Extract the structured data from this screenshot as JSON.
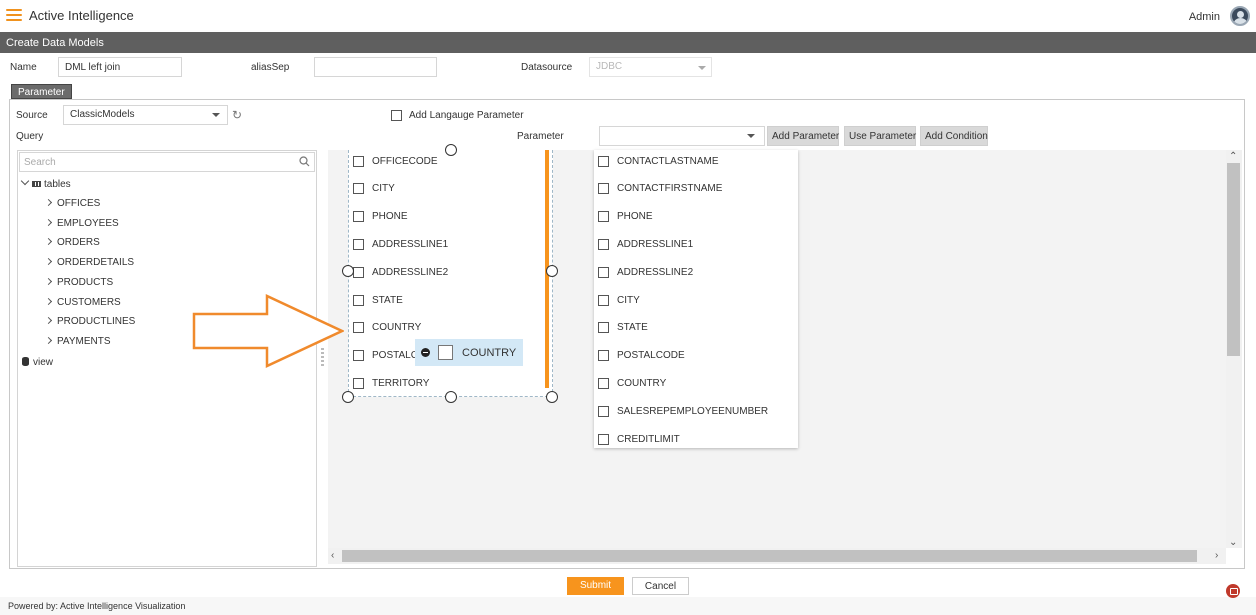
{
  "header": {
    "app_title": "Active Intelligence",
    "user_name": "Admin"
  },
  "page_title": "Create Data Models",
  "form": {
    "name_label": "Name",
    "name_value": "DML left join",
    "aliassep_label": "aliasSep",
    "aliassep_value": "",
    "datasource_label": "Datasource",
    "datasource_value": "JDBC"
  },
  "parameter_tab_label": "Parameter",
  "source": {
    "label": "Source",
    "value": "ClassicModels",
    "add_language_label": "Add Langauge Parameter"
  },
  "query_label": "Query",
  "parameter": {
    "label": "Parameter",
    "value": "",
    "add_parameter_label": "Add Parameter",
    "use_parameter_label": "Use Parameter",
    "add_condition_label": "Add Condition"
  },
  "tree": {
    "search_placeholder": "Search",
    "tables_label": "tables",
    "tables": [
      "OFFICES",
      "EMPLOYEES",
      "ORDERS",
      "ORDERDETAILS",
      "PRODUCTS",
      "CUSTOMERS",
      "PRODUCTLINES",
      "PAYMENTS"
    ],
    "view_label": "view"
  },
  "left_table_fields": [
    "OFFICECODE",
    "CITY",
    "PHONE",
    "ADDRESSLINE1",
    "ADDRESSLINE2",
    "STATE",
    "COUNTRY",
    "POSTALC",
    "TERRITORY"
  ],
  "right_table_fields": [
    "CONTACTLASTNAME",
    "CONTACTFIRSTNAME",
    "PHONE",
    "ADDRESSLINE1",
    "ADDRESSLINE2",
    "CITY",
    "STATE",
    "POSTALCODE",
    "COUNTRY",
    "SALESREPEMPLOYEENUMBER",
    "CREDITLIMIT"
  ],
  "drag_chip_label": "COUNTRY",
  "actions": {
    "submit_label": "Submit",
    "cancel_label": "Cancel"
  },
  "footer_text": "Powered by: Active Intelligence Visualization",
  "colors": {
    "accent": "#f7941d",
    "title_bar": "#5f5f5f",
    "drag_chip": "#d3e8f6"
  }
}
